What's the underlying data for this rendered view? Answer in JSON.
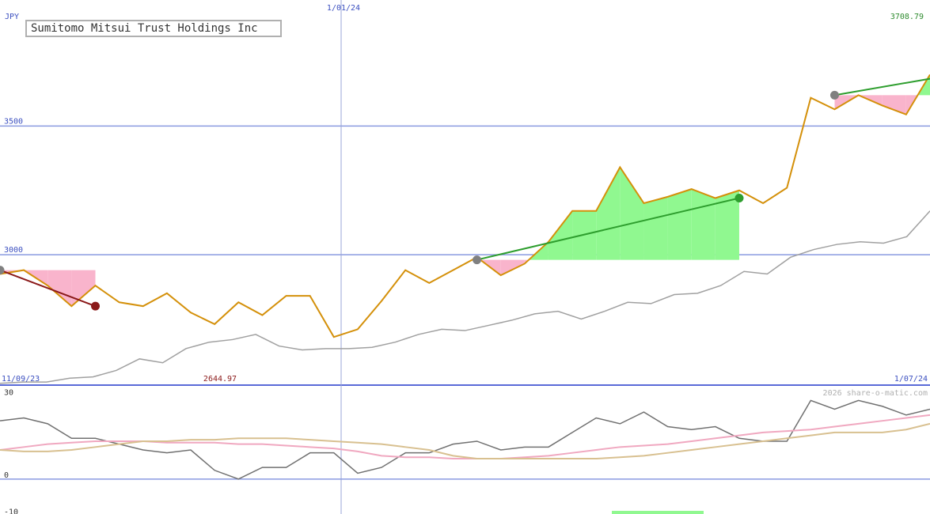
{
  "chart_data": {
    "type": "line",
    "title": "Sumitomo Mitsui Trust Holdings Inc",
    "currency_label": "JPY",
    "watermark": "2026 share-o-matic.com",
    "x_start_label": "11/09/23",
    "x_end_label": "1/07/24",
    "x_marker_label": "1/01/24",
    "max_label": "3708.79",
    "min_label": "2644.97",
    "price_ylim": [
      2490,
      3990
    ],
    "price_yticks": [
      {
        "value": 3000,
        "label": "3000"
      },
      {
        "value": 3500,
        "label": "3500"
      }
    ],
    "price_series": [
      2925,
      2940,
      2880,
      2800,
      2880,
      2815,
      2800,
      2850,
      2775,
      2730,
      2815,
      2765,
      2840,
      2840,
      2680,
      2710,
      2820,
      2940,
      2890,
      2940,
      2990,
      2920,
      2965,
      3050,
      3170,
      3170,
      3340,
      3200,
      3225,
      3255,
      3220,
      3250,
      3200,
      3260,
      3610,
      3565,
      3620,
      3580,
      3545,
      3700
    ],
    "comparison_series": [
      2500,
      2505,
      2505,
      2520,
      2525,
      2550,
      2595,
      2580,
      2635,
      2660,
      2670,
      2690,
      2645,
      2630,
      2635,
      2635,
      2640,
      2660,
      2690,
      2710,
      2705,
      2725,
      2745,
      2770,
      2780,
      2750,
      2780,
      2815,
      2810,
      2845,
      2850,
      2880,
      2935,
      2925,
      2990,
      3020,
      3040,
      3050,
      3045,
      3070,
      3170
    ],
    "trend_segments": [
      {
        "from_index": 0,
        "to_index": 4,
        "from_value": 2940,
        "to_value": 2800,
        "color": "#8b1a1a"
      },
      {
        "from_index": 20,
        "to_index": 31,
        "from_value": 2980,
        "to_value": 3220,
        "color": "#2e9e2e"
      },
      {
        "from_index": 35,
        "to_index": 40,
        "from_value": 3620,
        "to_value": 3700,
        "color": "#2e9e2e"
      }
    ],
    "osc_ylim": [
      -12,
      32
    ],
    "osc_yticks": [
      {
        "value": 30,
        "label": "30"
      },
      {
        "value": 0,
        "label": "0"
      },
      {
        "value": -10,
        "label": "-10"
      }
    ],
    "osc_series": [
      {
        "values": [
          20,
          21,
          19,
          14,
          14,
          12,
          10,
          9,
          10,
          3,
          0,
          4,
          4,
          9,
          9,
          2,
          4,
          9,
          9,
          12,
          13,
          10,
          11,
          11,
          16,
          21,
          19,
          23,
          18,
          17,
          18,
          14,
          13,
          13,
          27,
          24,
          27,
          25,
          22,
          24
        ],
        "color": "#707070"
      },
      {
        "values": [
          10,
          11,
          12,
          12.5,
          13,
          13,
          13,
          12.5,
          12.5,
          12.5,
          12,
          12,
          11.5,
          11,
          10.5,
          9.5,
          8,
          7.5,
          7.5,
          7,
          7,
          7,
          7.5,
          8,
          9,
          10,
          11,
          11.5,
          12,
          13,
          14,
          15,
          16,
          16.5,
          17,
          18,
          19,
          20,
          21,
          22
        ],
        "color": "#f0a8c0"
      },
      {
        "values": [
          10,
          9.5,
          9.5,
          10,
          11,
          12,
          13,
          13,
          13.5,
          13.5,
          14,
          14,
          14,
          13.5,
          13,
          12.5,
          12,
          11,
          10,
          8,
          7,
          7,
          7,
          7,
          7,
          7,
          7.5,
          8,
          9,
          10,
          11,
          12,
          13,
          14,
          15,
          16,
          16,
          16,
          17,
          19
        ],
        "color": "#d8c090"
      }
    ]
  }
}
